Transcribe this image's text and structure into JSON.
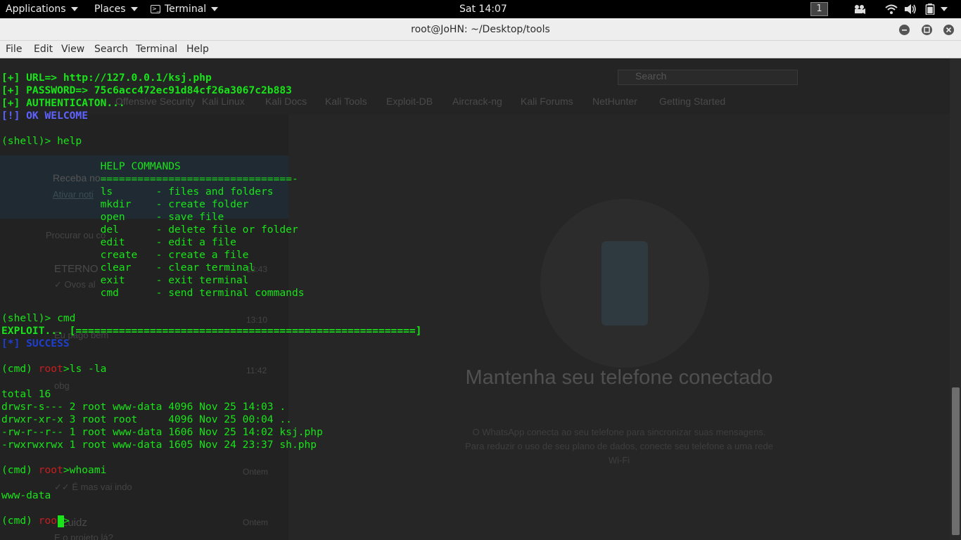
{
  "topbar": {
    "applications": "Applications",
    "places": "Places",
    "terminal": "Terminal",
    "clock": "Sat 14:07",
    "workspace": "1",
    "icons": [
      "video-icon",
      "wifi-icon",
      "volume-icon",
      "battery-icon",
      "power-menu-icon"
    ]
  },
  "window": {
    "title": "root@JoHN: ~/Desktop/tools",
    "buttons": [
      "minimize-icon",
      "maximize-icon",
      "close-icon"
    ]
  },
  "menubar": {
    "items": [
      "File",
      "Edit",
      "View",
      "Search",
      "Terminal",
      "Help"
    ]
  },
  "terminal": {
    "lines": [
      {
        "text": "[+] URL=> http://127.0.0.1/ksj.php"
      },
      {
        "text": "[+] PASSWORD=> 75c6acc472ec91d84cf26a3067c2b883"
      },
      {
        "text": "[+] AUTHENTICATON..."
      },
      {
        "text": "[!] OK WELCOME"
      },
      {
        "text": ""
      },
      {
        "text": "(shell)> help"
      },
      {
        "text": ""
      },
      {
        "text": "                HELP COMMANDS"
      },
      {
        "text": "                ===============================-"
      },
      {
        "text": "                ls       - files and folders"
      },
      {
        "text": "                mkdir    - create folder"
      },
      {
        "text": "                open     - save file"
      },
      {
        "text": "                del      - delete file or folder"
      },
      {
        "text": "                edit     - edit a file"
      },
      {
        "text": "                create   - create a file"
      },
      {
        "text": "                clear    - clear terminal"
      },
      {
        "text": "                exit     - exit terminal"
      },
      {
        "text": "                cmd      - send terminal commands"
      },
      {
        "text": ""
      },
      {
        "text": ""
      },
      {
        "text": "(shell)> cmd"
      },
      {
        "text": "EXPLOIT... [=======================================================]"
      },
      {
        "text": "[*] SUCCESS"
      },
      {
        "text": ""
      },
      {
        "text": "(cmd) root >ls -la"
      },
      {
        "text": ""
      },
      {
        "text": "total 16"
      },
      {
        "text": "drwsr-s--- 2 root www-data 4096 Nov 25 14:03 ."
      },
      {
        "text": "drwxr-xr-x 3 root root     4096 Nov 25 00:04 .."
      },
      {
        "text": "-rw-r--r-- 1 root www-data 1606 Nov 25 14:02 ksj.php"
      },
      {
        "text": "-rwxrwxrwx 1 root www-data 1605 Nov 24 23:37 sh.php"
      },
      {
        "text": ""
      },
      {
        "text": "(cmd) root >whoami"
      },
      {
        "text": ""
      },
      {
        "text": "www-data"
      },
      {
        "text": ""
      },
      {
        "text": "(cmd) root >"
      }
    ],
    "prompt_prefix": "(cmd) ",
    "prompt_user": "root",
    "prompt_sep": ">",
    "cmd_ls": "ls -la",
    "cmd_whoami": "whoami"
  },
  "ghost_background": {
    "search_placeholder": "Search",
    "bookmarks": [
      "Offensive Security",
      "Kali Linux",
      "Kali Docs",
      "Kali Tools",
      "Exploit-DB",
      "Aircrack-ng",
      "Kali Forums",
      "NetHunter",
      "Getting Started"
    ],
    "banner_title": "Receba no",
    "banner_link": "Ativar noti",
    "search_chat": "Procurar ou co",
    "chats": [
      {
        "name": "ETERNO",
        "preview": "✓ Ovos al",
        "time": "13:43"
      },
      {
        "name": "",
        "preview": "Eu pago bem",
        "time": "13:10"
      },
      {
        "name": "",
        "preview": "obg",
        "time": "11:42"
      },
      {
        "name": "",
        "preview": "✓✓ É mas vai indo",
        "time": "Ontem"
      },
      {
        "name": "Luidz",
        "preview": "E o projeto lá?",
        "time": "Ontem"
      }
    ],
    "main_title": "Mantenha seu telefone conectado",
    "main_text_1": "O WhatsApp conecta ao seu telefone para sincronizar suas mensagens.",
    "main_text_2": "Para reduzir o uso de seu plano de dados, conecte seu telefone a uma rede",
    "main_text_3": "Wi-Fi"
  }
}
